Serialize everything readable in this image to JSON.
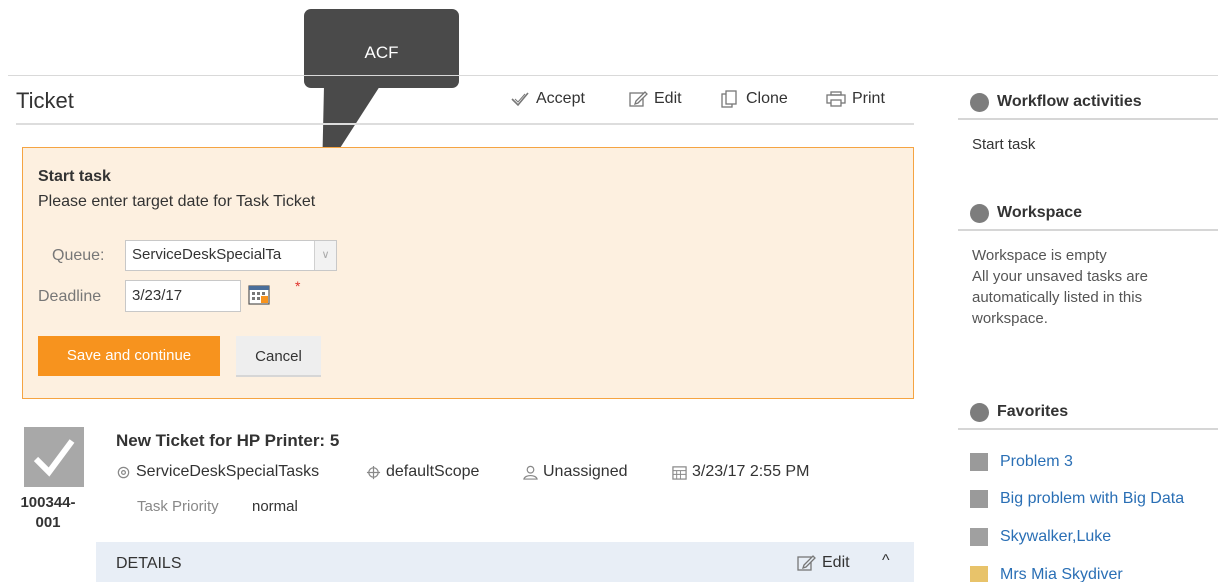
{
  "callout": {
    "text": "ACF"
  },
  "header": {
    "title": "Ticket",
    "actions": {
      "accept": "Accept",
      "edit": "Edit",
      "clone": "Clone",
      "print": "Print"
    }
  },
  "task_panel": {
    "title": "Start task",
    "description": "Please enter target date for Task Ticket",
    "queue_label": "Queue:",
    "queue_value": "ServiceDeskSpecialTa",
    "deadline_label": "Deadline",
    "deadline_value": "3/23/17",
    "required_marker": "*",
    "save_label": "Save and continue",
    "cancel_label": "Cancel",
    "accent_color": "#f7931e"
  },
  "ticket": {
    "id": "100344-001",
    "subject": "New Ticket for HP Printer: 5",
    "queue": "ServiceDeskSpecialTasks",
    "scope": "defaultScope",
    "assignee": "Unassigned",
    "created": "3/23/17 2:55 PM",
    "priority_label": "Task Priority",
    "priority_value": "normal"
  },
  "details": {
    "label": "DETAILS",
    "edit_label": "Edit",
    "toggle": "^"
  },
  "sidebar": {
    "workflow": {
      "title": "Workflow activities",
      "items": [
        "Start task"
      ]
    },
    "workspace": {
      "title": "Workspace",
      "empty_text": "Workspace is empty",
      "hint_lines": [
        "All your unsaved tasks are",
        "automatically listed in this",
        "workspace."
      ]
    },
    "favorites": {
      "title": "Favorites",
      "items": [
        {
          "label": "Problem 3",
          "icon": "problem-icon"
        },
        {
          "label": "Big problem with Big Data",
          "icon": "problem-icon"
        },
        {
          "label": "Skywalker,Luke",
          "icon": "at-icon"
        },
        {
          "label": "Mrs Mia Skydiver",
          "icon": "person-icon"
        }
      ]
    },
    "link_color": "#2a6fb5"
  }
}
